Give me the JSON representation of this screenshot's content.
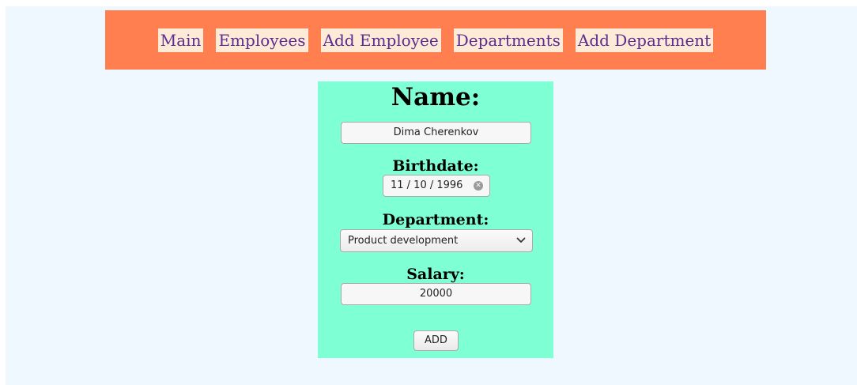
{
  "nav": {
    "items": [
      {
        "label": "Main"
      },
      {
        "label": "Employees"
      },
      {
        "label": "Add Employee"
      },
      {
        "label": "Departments"
      },
      {
        "label": "Add Department"
      }
    ]
  },
  "form": {
    "name_label": "Name:",
    "name_value": "Dima Cherenkov",
    "birthdate_label": "Birthdate:",
    "birthdate_value": "11 / 10 / 1996",
    "department_label": "Department:",
    "department_value": "Product development",
    "salary_label": "Salary:",
    "salary_value": "20000",
    "submit_label": "ADD"
  },
  "colors": {
    "nav_background": "#ff7f50",
    "nav_link_background": "#fdebd7",
    "nav_link_text": "#5b2d8e",
    "form_background": "#7fffd4",
    "page_background": "#f0f8ff"
  },
  "icons": {
    "date_clear": "clear-circle-icon",
    "select_arrow": "chevron-down-icon"
  }
}
